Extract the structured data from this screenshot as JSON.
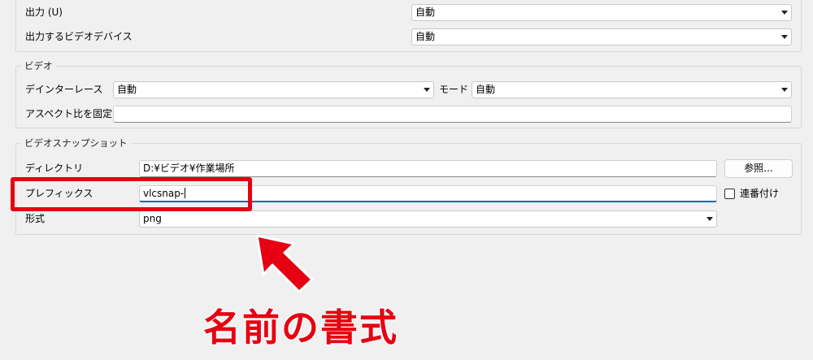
{
  "output": {
    "output_label": "出力 (U)",
    "output_value": "自動",
    "device_label": "出力するビデオデバイス",
    "device_value": "自動"
  },
  "video": {
    "legend": "ビデオ",
    "deinterlace_label": "デインターレース",
    "deinterlace_value": "自動",
    "mode_label": "モード",
    "mode_value": "自動",
    "aspect_label": "アスペクト比を固定",
    "aspect_value": ""
  },
  "snapshot": {
    "legend": "ビデオスナップショット",
    "directory_label": "ディレクトリ",
    "directory_value": "D:¥ビデオ¥作業場所",
    "browse_label": "参照...",
    "prefix_label": "プレフィックス",
    "prefix_value": "vlcsnap-",
    "sequential_label": "連番付け",
    "sequential_checked": false,
    "format_label": "形式",
    "format_value": "png"
  },
  "annotation": {
    "text": "名前の書式",
    "color": "#e60012"
  }
}
